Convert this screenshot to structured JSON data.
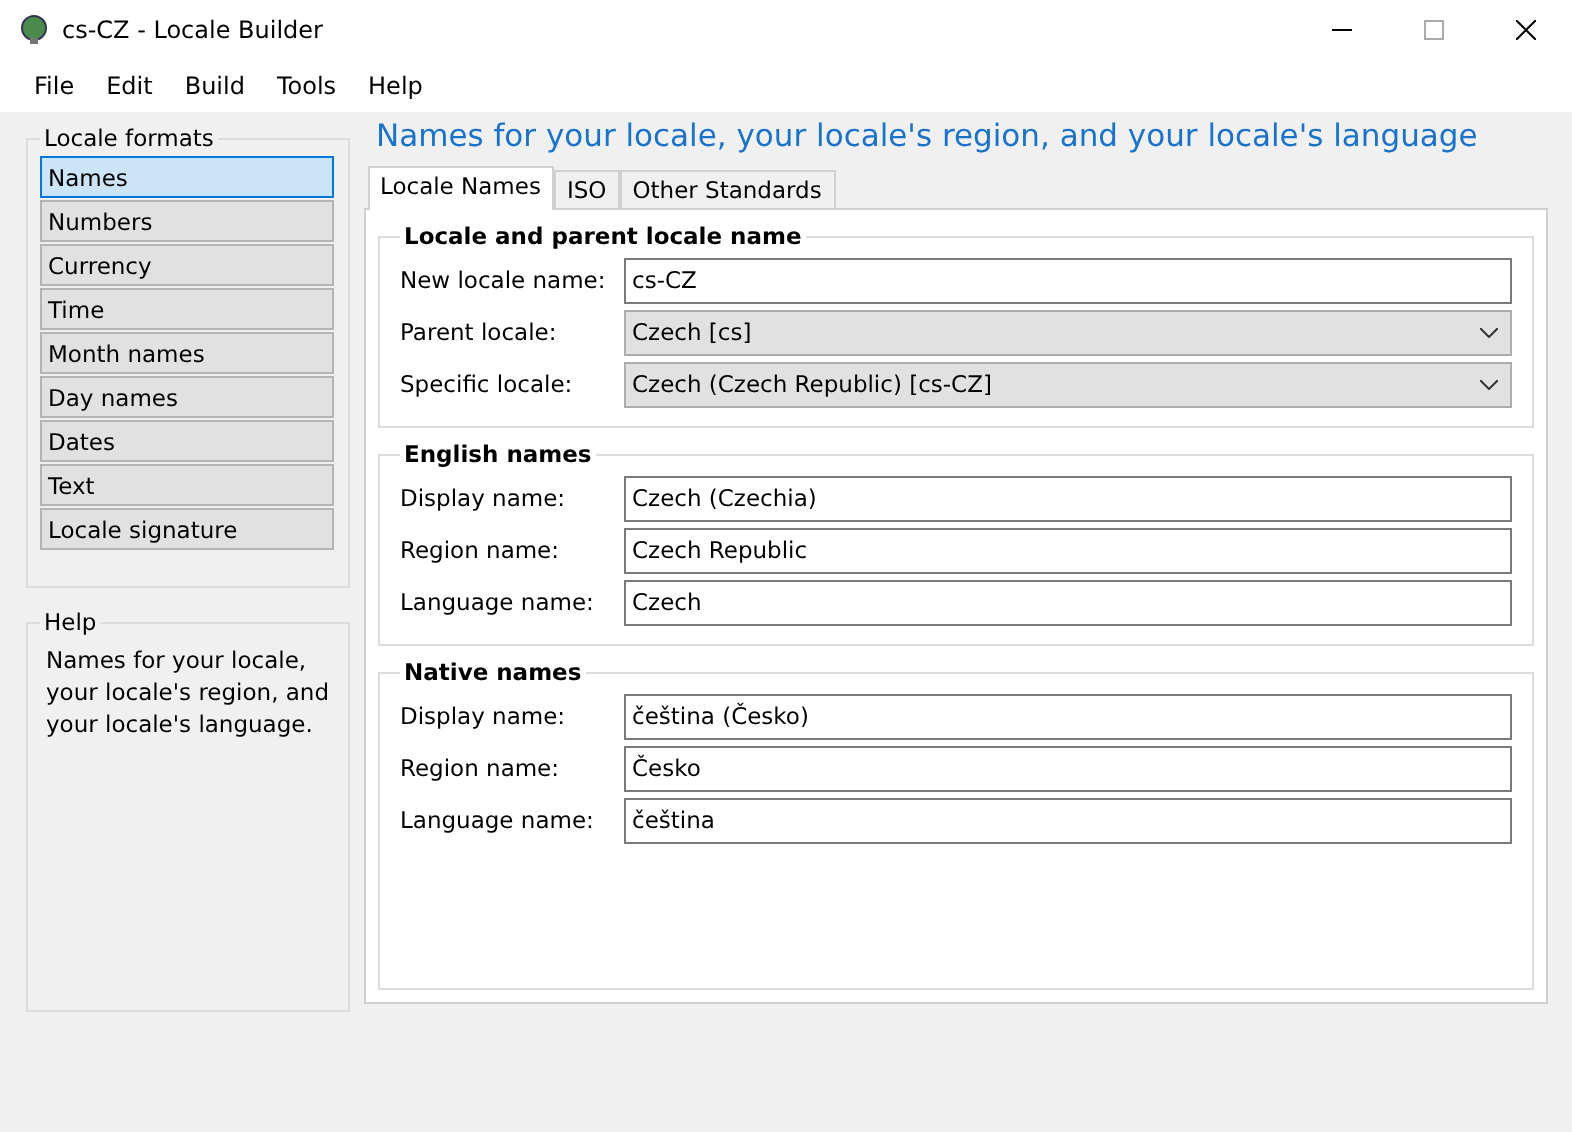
{
  "window": {
    "title": "cs-CZ - Locale Builder"
  },
  "menu": [
    "File",
    "Edit",
    "Build",
    "Tools",
    "Help"
  ],
  "locale_formats": {
    "title": "Locale formats",
    "items": [
      {
        "label": "Names",
        "selected": true
      },
      {
        "label": "Numbers",
        "selected": false
      },
      {
        "label": "Currency",
        "selected": false
      },
      {
        "label": "Time",
        "selected": false
      },
      {
        "label": "Month names",
        "selected": false
      },
      {
        "label": "Day names",
        "selected": false
      },
      {
        "label": "Dates",
        "selected": false
      },
      {
        "label": "Text",
        "selected": false
      },
      {
        "label": "Locale signature",
        "selected": false
      }
    ]
  },
  "help": {
    "title": "Help",
    "text": "Names for your locale, your locale's region, and your locale's language."
  },
  "heading": "Names for your locale, your locale's region, and your locale's language",
  "tabs": [
    {
      "label": "Locale Names",
      "selected": true
    },
    {
      "label": "ISO",
      "selected": false
    },
    {
      "label": "Other Standards",
      "selected": false
    }
  ],
  "groups": [
    {
      "title": "Locale and parent locale name",
      "fields": [
        {
          "label": "New locale name:",
          "kind": "text",
          "value": "cs-CZ"
        },
        {
          "label": "Parent locale:",
          "kind": "dropdown",
          "value": "Czech [cs]"
        },
        {
          "label": "Specific locale:",
          "kind": "dropdown",
          "value": "Czech (Czech Republic) [cs-CZ]"
        }
      ]
    },
    {
      "title": "English names",
      "fields": [
        {
          "label": "Display name:",
          "kind": "text",
          "value": "Czech (Czechia)"
        },
        {
          "label": "Region name:",
          "kind": "text",
          "value": "Czech Republic"
        },
        {
          "label": "Language name:",
          "kind": "text",
          "value": "Czech"
        }
      ]
    },
    {
      "title": "Native names",
      "fields": [
        {
          "label": "Display name:",
          "kind": "text",
          "value": "čeština (Česko)"
        },
        {
          "label": "Region name:",
          "kind": "text",
          "value": "Česko"
        },
        {
          "label": "Language name:",
          "kind": "text",
          "value": "čeština"
        }
      ]
    }
  ]
}
